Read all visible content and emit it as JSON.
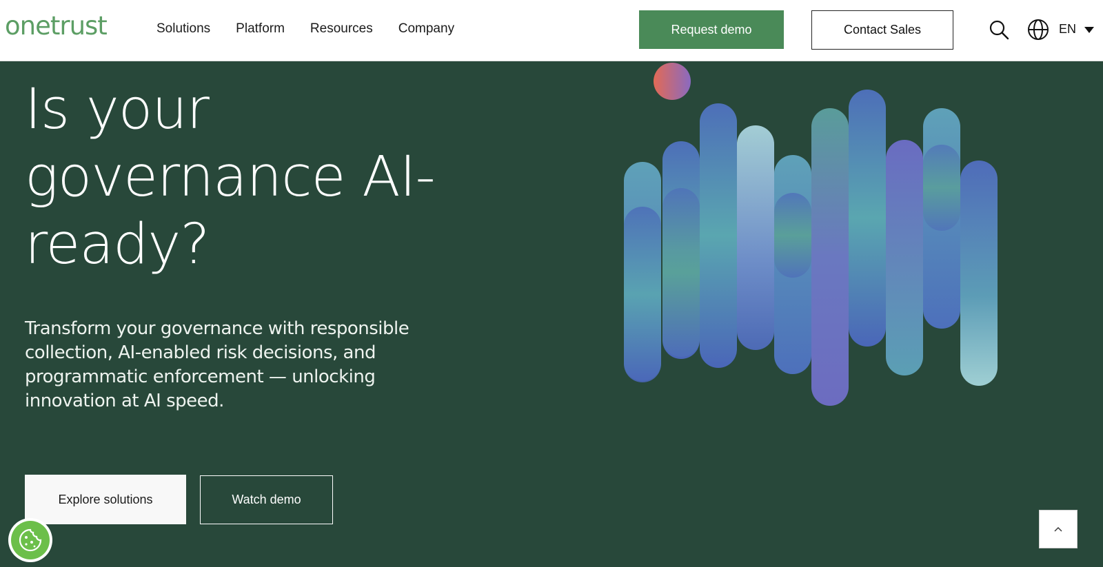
{
  "header": {
    "logo_text": "onetrust",
    "nav": [
      "Solutions",
      "Platform",
      "Resources",
      "Company"
    ],
    "request_demo_label": "Request demo",
    "contact_sales_label": "Contact Sales",
    "language": "EN",
    "icons": {
      "search": "search-icon",
      "language": "globe-icon",
      "dropdown": "caret-down-icon"
    }
  },
  "hero": {
    "title_lines": [
      "Is your",
      "governance AI-",
      "ready?"
    ],
    "subtitle_lines": [
      "Transform your governance with responsible",
      "collection, AI-enabled risk decisions, and",
      "programmatic enforcement — unlocking",
      "innovation at AI speed."
    ],
    "explore_label": "Explore solutions",
    "watch_label": "Watch demo"
  },
  "floating": {
    "cookie_icon": "cookie-icon",
    "scroll_top_icon": "chevron-up-icon"
  },
  "colors": {
    "brand_green": "#5c9e64",
    "cta_green": "#4a8a58",
    "hero_background": "#28483a"
  }
}
